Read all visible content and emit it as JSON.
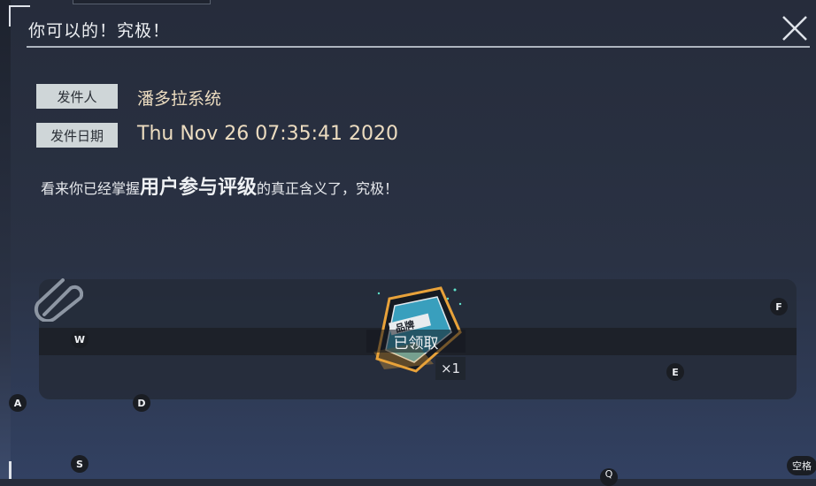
{
  "mail": {
    "title": "你可以的！究极！",
    "sender_label": "发件人",
    "sender": "潘多拉系统",
    "date_label": "发件日期",
    "date": "Thu Nov 26 07:35:41 2020",
    "body_prefix": "看来你已经掌握",
    "body_emphasis": "用户参与评级",
    "body_suffix": "的真正含义了，究极！"
  },
  "attachment": {
    "icon": "paperclip-icon",
    "item_icon": "brand-badge-icon",
    "item_badge_text": "品牌",
    "status": "已领取",
    "quantity": "×1"
  },
  "keys": {
    "w": "W",
    "a": "A",
    "s": "S",
    "d": "D",
    "e": "E",
    "f": "F",
    "space": "空格",
    "cut": "Q"
  },
  "colors": {
    "accent_gold": "#e8a23a",
    "badge_cyan": "#3fb7d8",
    "label_bg": "#cfd6d8",
    "value_text": "#ecdcc0"
  }
}
